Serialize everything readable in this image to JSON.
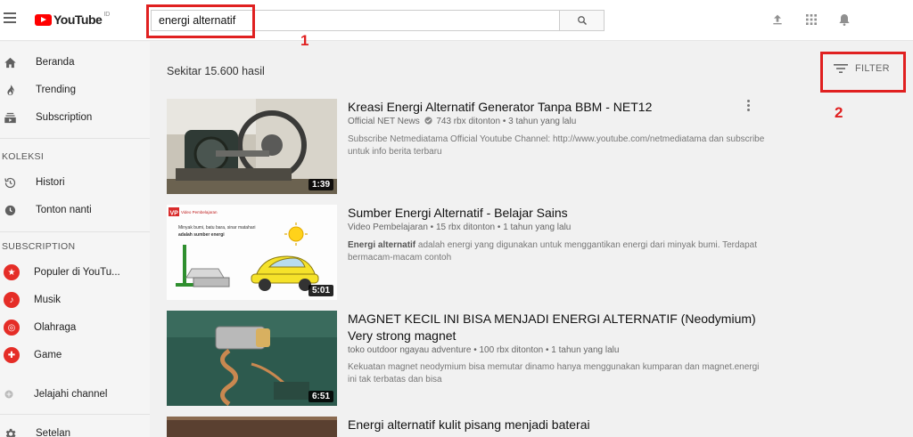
{
  "header": {
    "logo_text": "YouTube",
    "logo_region": "ID",
    "search_value": "energi alternatif"
  },
  "annotations": {
    "search_marker": "1",
    "filter_marker": "2"
  },
  "sidebar": {
    "main": [
      {
        "label": "Beranda",
        "icon": "home-icon"
      },
      {
        "label": "Trending",
        "icon": "flame-icon"
      },
      {
        "label": "Subscription",
        "icon": "subscriptions-icon"
      }
    ],
    "library_heading": "KOLEKSI",
    "library": [
      {
        "label": "Histori",
        "icon": "history-icon"
      },
      {
        "label": "Tonton nanti",
        "icon": "clock-icon"
      }
    ],
    "subs_heading": "SUBSCRIPTION",
    "subs": [
      {
        "label": "Populer di YouTu...",
        "icon": "star-icon"
      },
      {
        "label": "Musik",
        "icon": "music-icon"
      },
      {
        "label": "Olahraga",
        "icon": "ball-icon"
      },
      {
        "label": "Game",
        "icon": "gamepad-icon"
      }
    ],
    "browse": {
      "label": "Jelajahi channel",
      "icon": "plus-circle-icon"
    },
    "settings": {
      "label": "Setelan",
      "icon": "gear-icon"
    }
  },
  "results": {
    "count_text": "Sekitar 15.600 hasil",
    "filter_label": "FILTER"
  },
  "videos": [
    {
      "title": "Kreasi Energi Alternatif Generator Tanpa BBM - NET12",
      "channel": "Official NET News",
      "verified": true,
      "views": "743 rbx ditonton",
      "age": "3 tahun yang lalu",
      "desc": "Subscribe Netmediatama Official Youtube Channel: http://www.youtube.com/netmediatama dan subscribe untuk info berita terbaru",
      "duration": "1:39"
    },
    {
      "title": "Sumber Energi Alternatif - Belajar Sains",
      "channel": "Video Pembelajaran",
      "views": "15 rbx ditonton",
      "age": "1 tahun yang lalu",
      "desc_bold": "Energi alternatif",
      "desc_rest": " adalah energi yang digunakan untuk menggantikan energi dari minyak bumi. Terdapat bermacam-macam contoh",
      "duration": "5:01",
      "thumb_brand": "VP",
      "thumb_brand_text": "Video Pembelajaran",
      "thumb_caption": "Minyak bumi, batu bara, sinar matahari",
      "thumb_caption_bold": "adalah sumber energi"
    },
    {
      "title": "MAGNET KECIL INI BISA MENJADI ENERGI ALTERNATIF (Neodymium) Very strong magnet",
      "channel": "toko outdoor ngayau adventure",
      "views": "100 rbx ditonton",
      "age": "1 tahun yang lalu",
      "desc": "Kekuatan magnet neodymium bisa memutar dinamo hanya menggunakan kumparan dan magnet.energi ini tak terbatas dan bisa",
      "duration": "6:51"
    },
    {
      "title": "Energi alternatif kulit pisang menjadi baterai"
    }
  ],
  "colors": {
    "annotation": "#e02020",
    "brand": "#ff0000"
  }
}
